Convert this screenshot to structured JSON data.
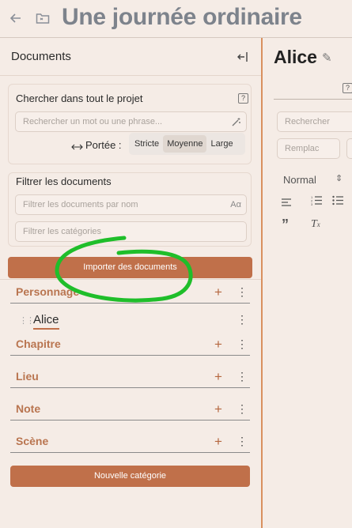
{
  "topbar": {
    "back_icon": "arrow-left-icon",
    "folder_icon": "folder-icon",
    "title": "Une journée ordinaire"
  },
  "sidebar": {
    "title": "Documents",
    "collapse_icon": "collapse-left-icon",
    "search": {
      "label": "Chercher dans tout le projet",
      "placeholder": "Rechercher un mot ou une phrase...",
      "scope_label": "Portée :",
      "scope_options": [
        "Stricte",
        "Moyenne",
        "Large"
      ],
      "scope_selected": "Moyenne"
    },
    "filter": {
      "label": "Filtrer les documents",
      "name_placeholder": "Filtrer les documents par nom",
      "case_icon_text": "Aα",
      "categories_placeholder": "Filtrer les catégories"
    },
    "import_button": "Importer des documents",
    "categories": [
      {
        "name": "Personnage",
        "documents": [
          "Alice"
        ]
      },
      {
        "name": "Chapitre",
        "documents": []
      },
      {
        "name": "Lieu",
        "documents": []
      },
      {
        "name": "Note",
        "documents": []
      },
      {
        "name": "Scène",
        "documents": []
      }
    ],
    "new_category_button": "Nouvelle catégorie"
  },
  "editor": {
    "title": "Alice",
    "search_placeholder": "Rechercher",
    "replace_placeholder": "Remplac",
    "paragraph_style": "Normal"
  },
  "colors": {
    "accent": "#c0704a",
    "category_text": "#b97550",
    "background": "#f5ece6",
    "annotation": "#1fbe2a"
  }
}
